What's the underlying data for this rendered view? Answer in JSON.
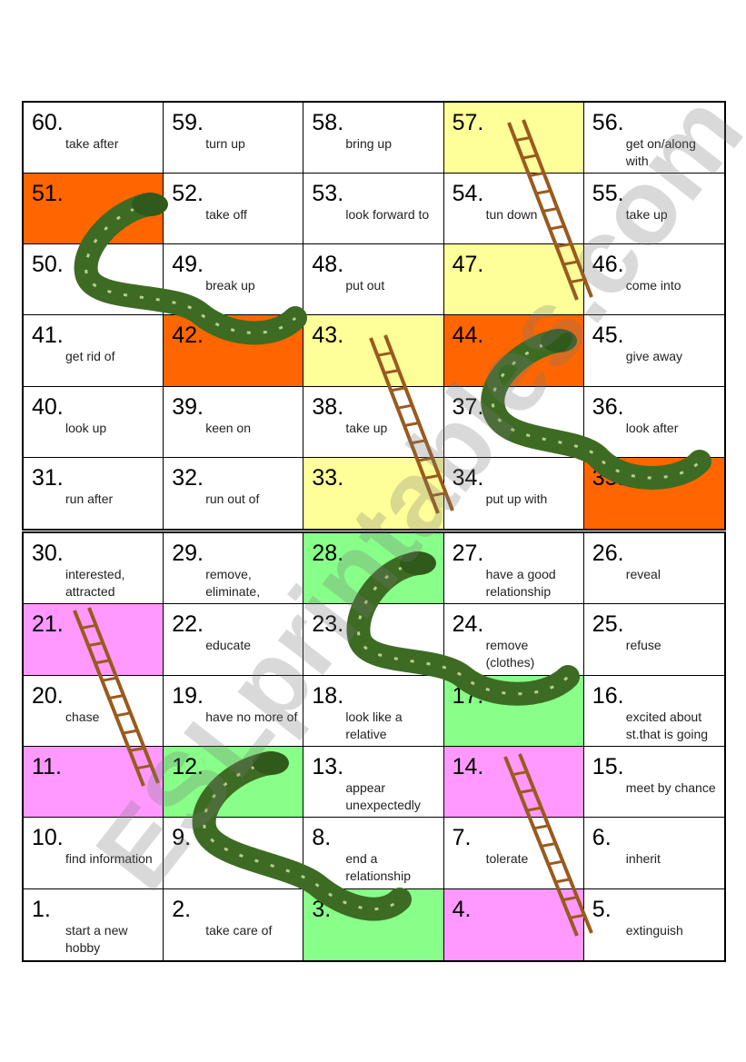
{
  "colors": {
    "yellow": "#ffff99",
    "orange": "#ff6600",
    "green": "#88ff88",
    "pink": "#ff99ff",
    "white": "#ffffff",
    "snake": "#3d6b23",
    "ladder": "#9a5a1e"
  },
  "watermark": "ESLprintables.com",
  "top_board": [
    {
      "n": "60.",
      "t": "take after",
      "c": "white"
    },
    {
      "n": "59.",
      "t": "turn up",
      "c": "white"
    },
    {
      "n": "58.",
      "t": "bring up",
      "c": "white"
    },
    {
      "n": "57.",
      "t": "",
      "c": "yellow"
    },
    {
      "n": "56.",
      "t": "get on/along with",
      "c": "white"
    },
    {
      "n": "51.",
      "t": "",
      "c": "orange"
    },
    {
      "n": "52.",
      "t": "take off",
      "c": "white"
    },
    {
      "n": "53.",
      "t": "look forward to",
      "c": "white"
    },
    {
      "n": "54.",
      "t": "tun down",
      "c": "white"
    },
    {
      "n": "55.",
      "t": "take up",
      "c": "white"
    },
    {
      "n": "50.",
      "t": "",
      "c": "white"
    },
    {
      "n": "49.",
      "t": "break up",
      "c": "white"
    },
    {
      "n": "48.",
      "t": "put out",
      "c": "white"
    },
    {
      "n": "47.",
      "t": "",
      "c": "yellow"
    },
    {
      "n": "46.",
      "t": "come into",
      "c": "white"
    },
    {
      "n": "41.",
      "t": "get rid of",
      "c": "white"
    },
    {
      "n": "42.",
      "t": "",
      "c": "orange"
    },
    {
      "n": "43.",
      "t": "",
      "c": "yellow"
    },
    {
      "n": "44.",
      "t": "",
      "c": "orange"
    },
    {
      "n": "45.",
      "t": "give away",
      "c": "white"
    },
    {
      "n": "40.",
      "t": "look up",
      "c": "white"
    },
    {
      "n": "39.",
      "t": "keen on",
      "c": "white"
    },
    {
      "n": "38.",
      "t": "take up",
      "c": "white"
    },
    {
      "n": "37.",
      "t": "",
      "c": "white"
    },
    {
      "n": "36.",
      "t": "look after",
      "c": "white"
    },
    {
      "n": "31.",
      "t": "run after",
      "c": "white"
    },
    {
      "n": "32.",
      "t": "run out of",
      "c": "white"
    },
    {
      "n": "33.",
      "t": "",
      "c": "yellow"
    },
    {
      "n": "34.",
      "t": "put up with",
      "c": "white"
    },
    {
      "n": "35.",
      "t": "",
      "c": "orange"
    }
  ],
  "bottom_board": [
    {
      "n": "30.",
      "t": "interested, attracted",
      "c": "white"
    },
    {
      "n": "29.",
      "t": "remove, eliminate, abolish",
      "c": "white"
    },
    {
      "n": "28.",
      "t": "",
      "c": "green"
    },
    {
      "n": "27.",
      "t": "have a good relationship",
      "c": "white"
    },
    {
      "n": "26.",
      "t": "reveal",
      "c": "white"
    },
    {
      "n": "21.",
      "t": "",
      "c": "pink"
    },
    {
      "n": "22.",
      "t": "educate",
      "c": "white"
    },
    {
      "n": "23.",
      "t": "",
      "c": "white"
    },
    {
      "n": "24.",
      "t": "remove (clothes)",
      "c": "white"
    },
    {
      "n": "25.",
      "t": "refuse",
      "c": "white"
    },
    {
      "n": "20.",
      "t": "chase",
      "c": "white"
    },
    {
      "n": "19.",
      "t": "have no more of",
      "c": "white"
    },
    {
      "n": "18.",
      "t": "look like a relative",
      "c": "white"
    },
    {
      "n": "17.",
      "t": "",
      "c": "green"
    },
    {
      "n": "16.",
      "t": "excited about st.that is going to happen",
      "c": "white"
    },
    {
      "n": "11.",
      "t": "",
      "c": "pink"
    },
    {
      "n": "12.",
      "t": "",
      "c": "green"
    },
    {
      "n": "13.",
      "t": "appear unexpectedly",
      "c": "white"
    },
    {
      "n": "14.",
      "t": "",
      "c": "pink"
    },
    {
      "n": "15.",
      "t": "meet by chance",
      "c": "white"
    },
    {
      "n": "10.",
      "t": "find information",
      "c": "white"
    },
    {
      "n": "9.",
      "t": "",
      "c": "white"
    },
    {
      "n": "8.",
      "t": "end a relationship",
      "c": "white"
    },
    {
      "n": "7.",
      "t": "tolerate",
      "c": "white"
    },
    {
      "n": "6.",
      "t": "inherit",
      "c": "white"
    },
    {
      "n": "1.",
      "t": "start a new hobby",
      "c": "white"
    },
    {
      "n": "2.",
      "t": "take care of",
      "c": "white"
    },
    {
      "n": "3.",
      "t": "",
      "c": "green"
    },
    {
      "n": "4.",
      "t": "",
      "c": "pink"
    },
    {
      "n": "5.",
      "t": "extinguish",
      "c": "white"
    }
  ]
}
